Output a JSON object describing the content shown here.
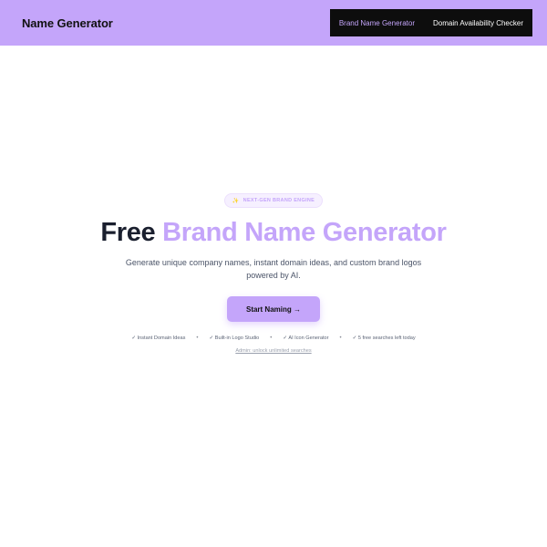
{
  "header": {
    "logo": "Name Generator",
    "nav": [
      {
        "label": "Brand Name Generator",
        "active": true
      },
      {
        "label": "Domain Availability Checker",
        "active": false
      }
    ]
  },
  "hero": {
    "badge": "NEXT-GEN BRAND ENGINE",
    "badge_icon": "sparkle-icon",
    "title_part1": "Free",
    "title_part2": "Brand Name Generator",
    "subtitle": "Generate unique company names, instant domain ideas, and custom brand logos powered by AI.",
    "cta_label": "Start Naming →",
    "features": [
      "✓ Instant Domain Ideas",
      "✓ Built-in Logo Studio",
      "✓ AI Icon Generator",
      "✓ 5 free searches left today"
    ],
    "separator": "•",
    "admin_link": "Admin: unlock unlimited searches"
  },
  "colors": {
    "accent": "#c4a5fa",
    "nav_background": "#0d0d0d",
    "title_dark": "#1a1f2e"
  }
}
